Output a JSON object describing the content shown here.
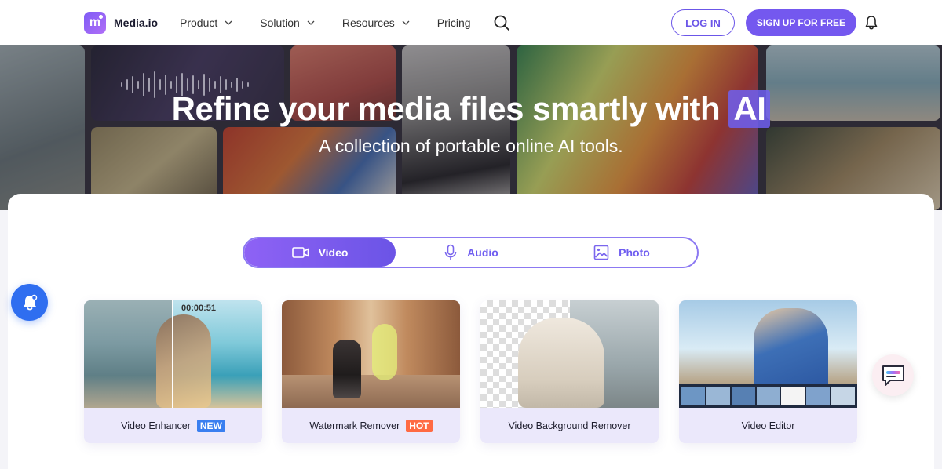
{
  "brand": {
    "name": "Media.io",
    "logo_glyph": "m"
  },
  "nav": {
    "items": [
      {
        "label": "Product",
        "has_dropdown": true
      },
      {
        "label": "Solution",
        "has_dropdown": true
      },
      {
        "label": "Resources",
        "has_dropdown": true
      },
      {
        "label": "Pricing",
        "has_dropdown": false
      }
    ],
    "login_label": "LOG IN",
    "signup_label": "SIGN UP FOR FREE"
  },
  "hero": {
    "title_main": "Refine your media files smartly with",
    "title_highlight": "AI",
    "subtitle": "A collection of portable online AI tools."
  },
  "tabs": [
    {
      "label": "Video",
      "icon": "video-icon",
      "active": true
    },
    {
      "label": "Audio",
      "icon": "microphone-icon",
      "active": false
    },
    {
      "label": "Photo",
      "icon": "image-icon",
      "active": false
    }
  ],
  "cards": [
    {
      "label": "Video Enhancer",
      "badge": "NEW",
      "timecode": "00:00:51"
    },
    {
      "label": "Watermark Remover",
      "badge": "HOT"
    },
    {
      "label": "Video Background Remover"
    },
    {
      "label": "Video Editor"
    }
  ],
  "colors": {
    "accent": "#7458ef",
    "badge_new": "#3a7ff0",
    "badge_hot": "#ff6a43",
    "float_bell": "#2f6ef0"
  }
}
